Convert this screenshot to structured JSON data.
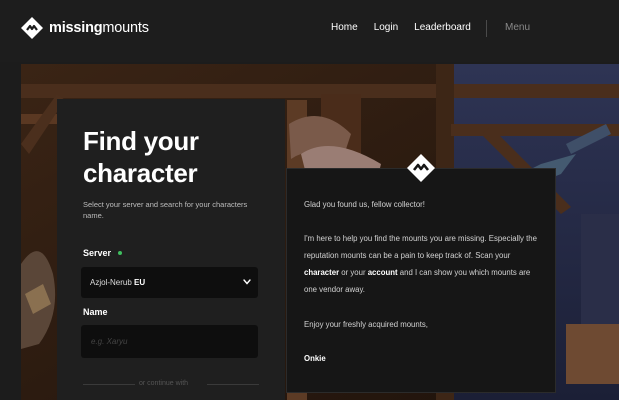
{
  "brand": {
    "name_bold": "missing",
    "name_light": "mounts"
  },
  "nav": {
    "links": [
      "Home",
      "Login",
      "Leaderboard"
    ],
    "menu": "Menu"
  },
  "search": {
    "title": "Find your character",
    "subtitle": "Select your server and search for your characters name.",
    "server_label": "Server",
    "server_value_name": "Azjol-Nerub",
    "server_value_region": "EU",
    "name_label": "Name",
    "name_placeholder": "e.g. Xaryu",
    "divider_text": "or continue with"
  },
  "message": {
    "greeting": "Glad you found us, fellow collector!",
    "body_1": "I'm here to help you find the mounts you are missing. Especially the reputation mounts can be a pain to keep track of. Scan your ",
    "body_character": "character",
    "body_2": " or your ",
    "body_account": "account",
    "body_3": " and I can show you which mounts are one vendor away.",
    "closing": "Enjoy your freshly acquired mounts,",
    "signature": "Onkie"
  },
  "colors": {
    "accent_green": "#3fbf5f",
    "card_bg": "#1f1f1f",
    "message_bg": "#161616",
    "input_bg": "#0e0e0e"
  },
  "icons": [
    "logo-icon",
    "chevron-down-icon",
    "status-dot-icon",
    "bot-logo-icon"
  ]
}
